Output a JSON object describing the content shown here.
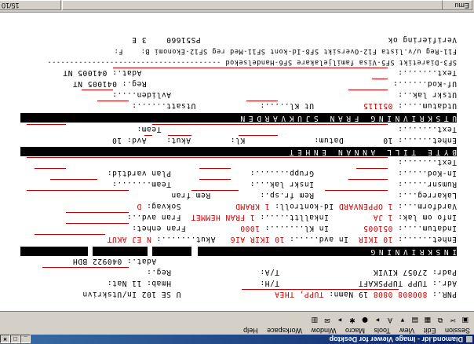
{
  "window": {
    "title": "Diamond.idr - Image Viewer for Desktop",
    "minimize": "_",
    "maximize": "□",
    "close": "×"
  },
  "menu": [
    "Session",
    "Edit",
    "View",
    "Tools",
    "Macro",
    "Window",
    "Workspace",
    "Help"
  ],
  "toolbar": [
    "▣",
    "✂",
    "⧉",
    "▦",
    "▤",
    "▾",
    "A",
    "▸",
    "●",
    "✱",
    "▸",
    "✉",
    "▥"
  ],
  "status": {
    "left": "Emu   MO 1",
    "cursor": "",
    "page": "15/10"
  },
  "screen": {
    "header_left": "Verifiering ok",
    "header_mid": "PS51660",
    "header_right": "3 E",
    "menu_line": "F11-Reg u/v.lista F12-Oversikt SF8-Id-kont SF11-Med reg SF12-Ekonomi B:    F:",
    "section_line": "SF3-Diaretikt SF5-Visa familjelakare SF6-Handelsekod ---------------------------------------",
    "rows": [
      {
        "label": "Text.......:",
        "right_label": "Adat.:",
        "right_value": "041005 NT"
      },
      {
        "label": "Uf-Kod......:",
        "right_label": "Reg.:",
        "right_value": "041005 NT"
      },
      {
        "label": "Utskr lak..:",
        "right_label": "Avliden....:",
        "right_value": ""
      },
      {
        "label": "Utdatum....:",
        "value": "051115",
        "mid_label": "Ut Kl.....:",
        "right_label": "Utsatt......:"
      }
    ],
    "bar_utskrivning": "UTSKRIVNING FRAN SJUKVARDEN",
    "utskr_rows": [
      {
        "label": "Text.......:",
        "right_label": "Team:"
      },
      {
        "label": "Enhet......:",
        "value": "10",
        "mid": "Datum:",
        "kl": "Kl:",
        "akut": "Akut:",
        "avd": "Avd:",
        "avd_value": "10"
      }
    ],
    "bar_byte": "BYTE TILL ANNAN ENHET",
    "byte_rows": [
      {
        "label": "Text.......:"
      },
      {
        "label": "In-Kod.....:",
        "mid_label": "Grupp.......:",
        "right_label": "Plan vardtid:"
      },
      {
        "label": "Rumsnr.....:",
        "mid_label": "Inskr lak...:",
        "right_label": "Team.......:"
      },
      {
        "label": "Lakarreg...:",
        "mid_label": "Rem fr.sp.:",
        "mid2": "Rem fran",
        "right_label": ""
      },
      {
        "label": "Vardform...:",
        "value": "1 OPPENVARD",
        "mid_label": "Id-kontroll:",
        "mid_value": "1 KRAMD",
        "right_label": "Sokvag:",
        "right_value": "D"
      },
      {
        "label": "Info om lak:",
        "value": "1 JA",
        "mid_label": "Inkalltt.....:",
        "mid_value": "1 FRAN HEMMET",
        "right_label": "Fran avd..:"
      },
      {
        "label": "Indatum....:",
        "value": "051005",
        "mid_label": "In Kl.......:",
        "mid_value": "1000",
        "right_label": "Fran enhet:"
      },
      {
        "label": "Enhet......:",
        "value": "10 IKIR",
        "mid_label": "In avd.....:",
        "mid_value": "10 IKIR",
        "mid_value2": "AI6",
        "right_label": "Akut.......:",
        "right_value": "N EJ AKUT"
      }
    ],
    "bar_inskrivning": "INSKRIVNING",
    "pat_rows": [
      {
        "label": "",
        "right_label": "Adat.:",
        "right_value": "040922 BDH"
      },
      {
        "label": "Padr: 27057 KIVIK",
        "mid_label": "T/A:",
        "right_label": "Reg.:"
      },
      {
        "label": "Adr.: TUPP TUPPSKAFT",
        "mid_label": "T/H:",
        "right_label": "Hmab: 11 Nat:"
      },
      {
        "label": "PNR.:",
        "value": "800808 0808",
        "name_label": "19 Namn:",
        "name_value": "TUPP, THEA",
        "right_value": "U SE 102 In/Utskrivn"
      }
    ]
  }
}
